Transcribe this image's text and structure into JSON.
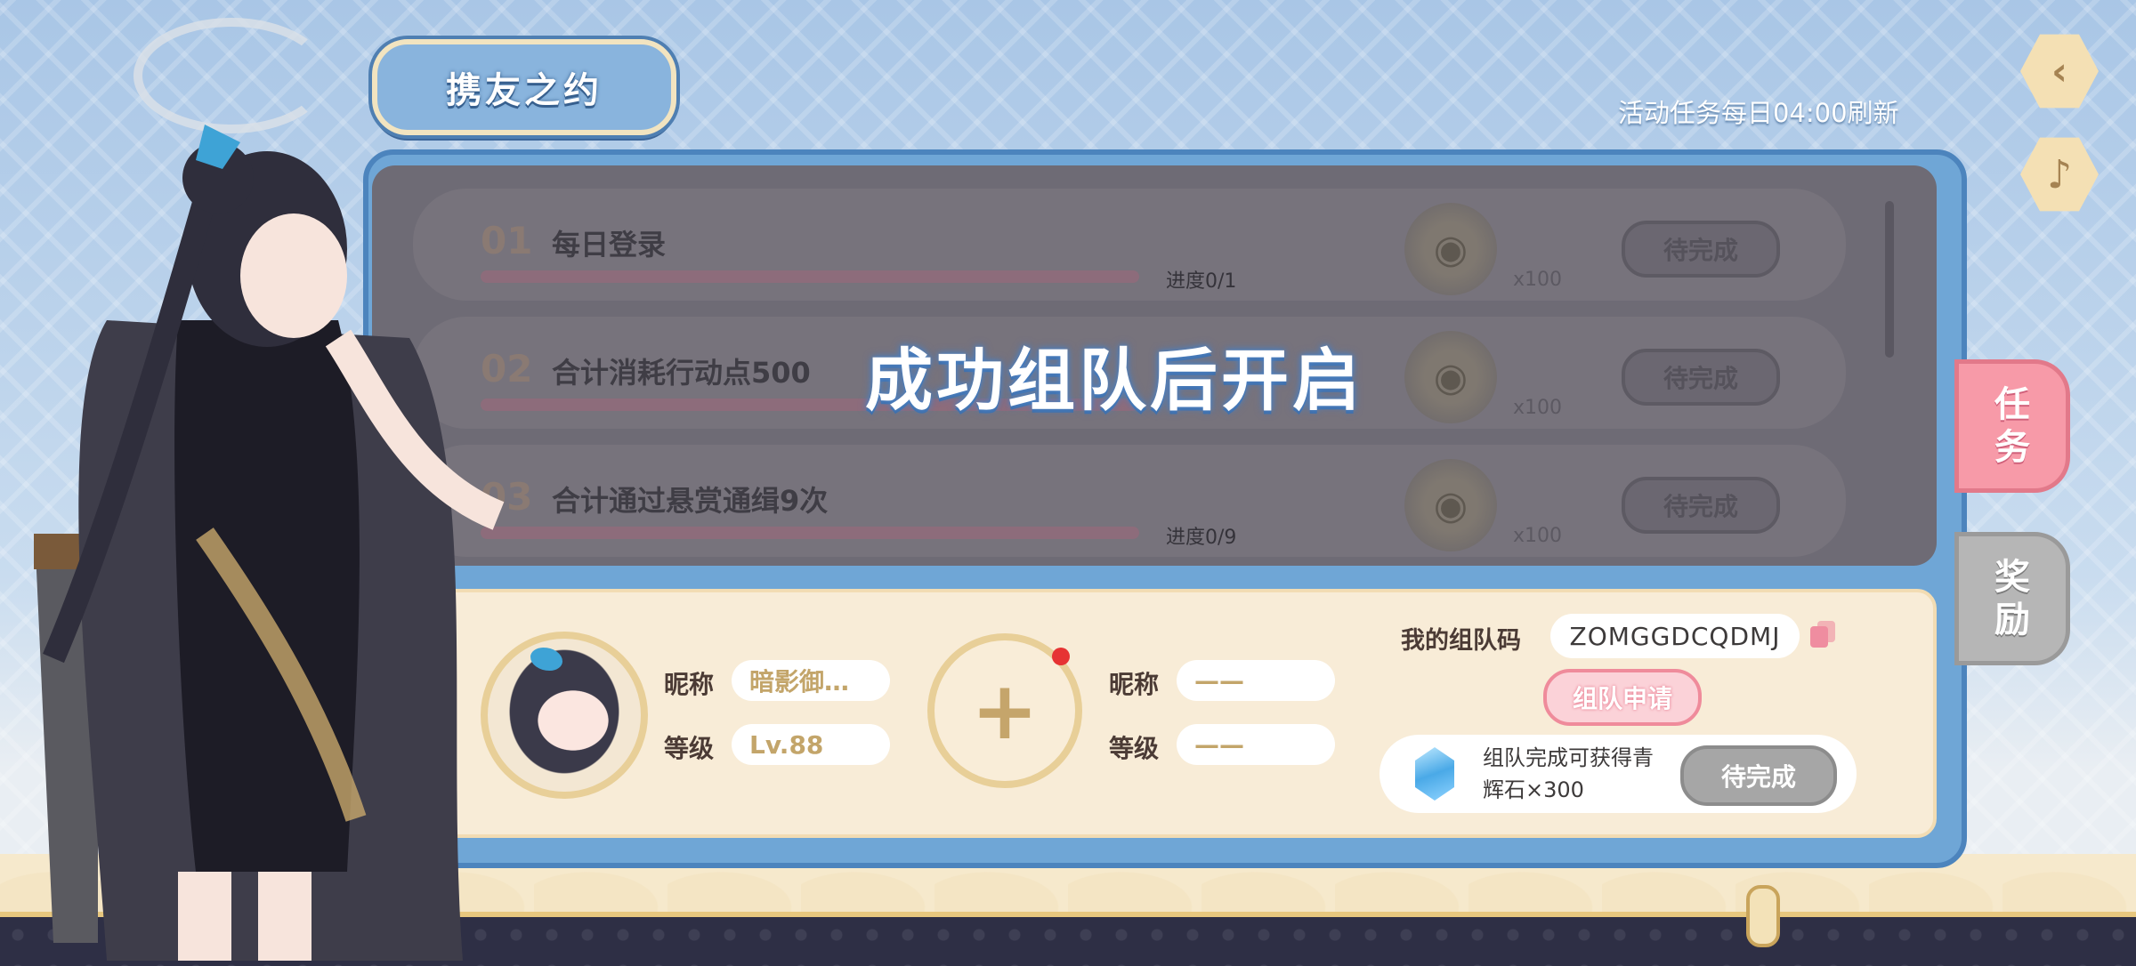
{
  "header": {
    "title": "携友之约",
    "refresh_note": "活动任务每日04:00刷新"
  },
  "buttons": {
    "back": "‹",
    "mute": "♪"
  },
  "tasks": [
    {
      "num": "01",
      "title": "每日登录",
      "progress": "进度0/1",
      "reward_count": "x100",
      "status": "待完成"
    },
    {
      "num": "02",
      "title": "合计消耗行动点500",
      "progress": "",
      "reward_count": "x100",
      "status": "待完成"
    },
    {
      "num": "03",
      "title": "合计通过悬赏通缉9次",
      "progress": "进度0/9",
      "reward_count": "x100",
      "status": "待完成"
    }
  ],
  "overlay": {
    "locked_message": "成功组队后开启"
  },
  "team": {
    "self": {
      "nickname_label": "昵称",
      "nickname": "暗影御…",
      "level_label": "等级",
      "level": "Lv.88"
    },
    "partner": {
      "nickname_label": "昵称",
      "nickname": "——",
      "level_label": "等级",
      "level": "——",
      "add_symbol": "+"
    },
    "code_label": "我的组队码",
    "code": "ZOMGGDCQDMJ",
    "apply_label": "组队申请",
    "reward_text": "组队完成可获得青辉石×300",
    "reward_status": "待完成"
  },
  "tabs": {
    "tasks": "任务",
    "rewards": "奖励"
  },
  "colors": {
    "accent_blue": "#6fa6d6",
    "pink": "#f79aa8",
    "cream": "#f8ecd7",
    "gold": "#c3a56a"
  }
}
